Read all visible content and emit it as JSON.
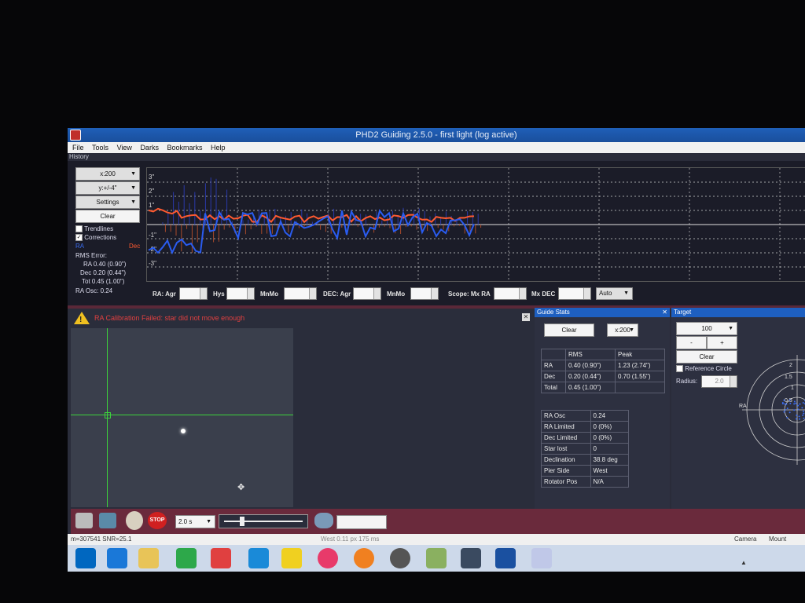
{
  "window_title": "PHD2 Guiding 2.5.0 - first light (log active)",
  "menu": [
    "File",
    "Tools",
    "View",
    "Darks",
    "Bookmarks",
    "Help"
  ],
  "history": {
    "label": "History",
    "x_scale": "x:200",
    "y_scale": "y:+/-4\"",
    "settings_label": "Settings",
    "clear_label": "Clear",
    "trendlines_label": "Trendlines",
    "trendlines_checked": false,
    "corrections_label": "Corrections",
    "corrections_checked": true,
    "ra_legend": "RA",
    "dec_legend": "Dec",
    "rms_title": "RMS Error:",
    "rms_ra": "RA 0.40 (0.90\")",
    "rms_dec": "Dec 0.20 (0.44\")",
    "rms_tot": "Tot 0.45 (1.00\")",
    "ra_osc": "RA Osc: 0.24",
    "y_ticks": [
      "3\"",
      "2\"",
      "1\"",
      "-1\"",
      "-2\"",
      "-3\""
    ]
  },
  "params": {
    "ra_agr": "RA: Agr",
    "hys": "Hys",
    "mnmo1": "MnMo",
    "dec_agr": "DEC: Agr",
    "mnmo2": "MnMo",
    "scope_mx_ra": "Scope: Mx RA",
    "mx_dec": "Mx DEC",
    "mode": "Auto"
  },
  "alert": {
    "text": "RA Calibration Failed: star did not move enough",
    "color": "#e04040"
  },
  "guide_stats": {
    "title": "Guide Stats",
    "clear_label": "Clear",
    "x_scale": "x:200",
    "headers": [
      "",
      "RMS",
      "Peak"
    ],
    "rows": [
      [
        "RA",
        "0.40 (0.90\")",
        "1.23 (2.74\")"
      ],
      [
        "Dec",
        "0.20 (0.44\")",
        "0.70 (1.55\")"
      ],
      [
        "Total",
        "0.45 (1.00\")",
        ""
      ]
    ],
    "details": [
      [
        "RA Osc",
        "0.24"
      ],
      [
        "RA Limited",
        "0 (0%)"
      ],
      [
        "Dec Limited",
        "0 (0%)"
      ],
      [
        "Star lost",
        "0"
      ],
      [
        "Declination",
        "38.8 deg"
      ],
      [
        "Pier Side",
        "West"
      ],
      [
        "Rotator Pos",
        "N/A"
      ]
    ]
  },
  "target": {
    "title": "Target",
    "zoom": "100",
    "minus": "-",
    "plus": "+",
    "clear_label": "Clear",
    "ref_circle_label": "Reference Circle",
    "radius_label": "Radius:",
    "radius_value": "2.0",
    "ring_labels": [
      "2",
      "1.5",
      "1",
      "0.5"
    ],
    "ra_axis": "RA"
  },
  "toolbar": {
    "stop_label": "STOP",
    "exposure": "2.0 s",
    "exposure_fraction": 0.2
  },
  "status": {
    "left": "m=307541 SNR=25.1",
    "middle": "West 0.11 px 175 ms",
    "camera": "Camera",
    "mount": "Mount"
  }
}
